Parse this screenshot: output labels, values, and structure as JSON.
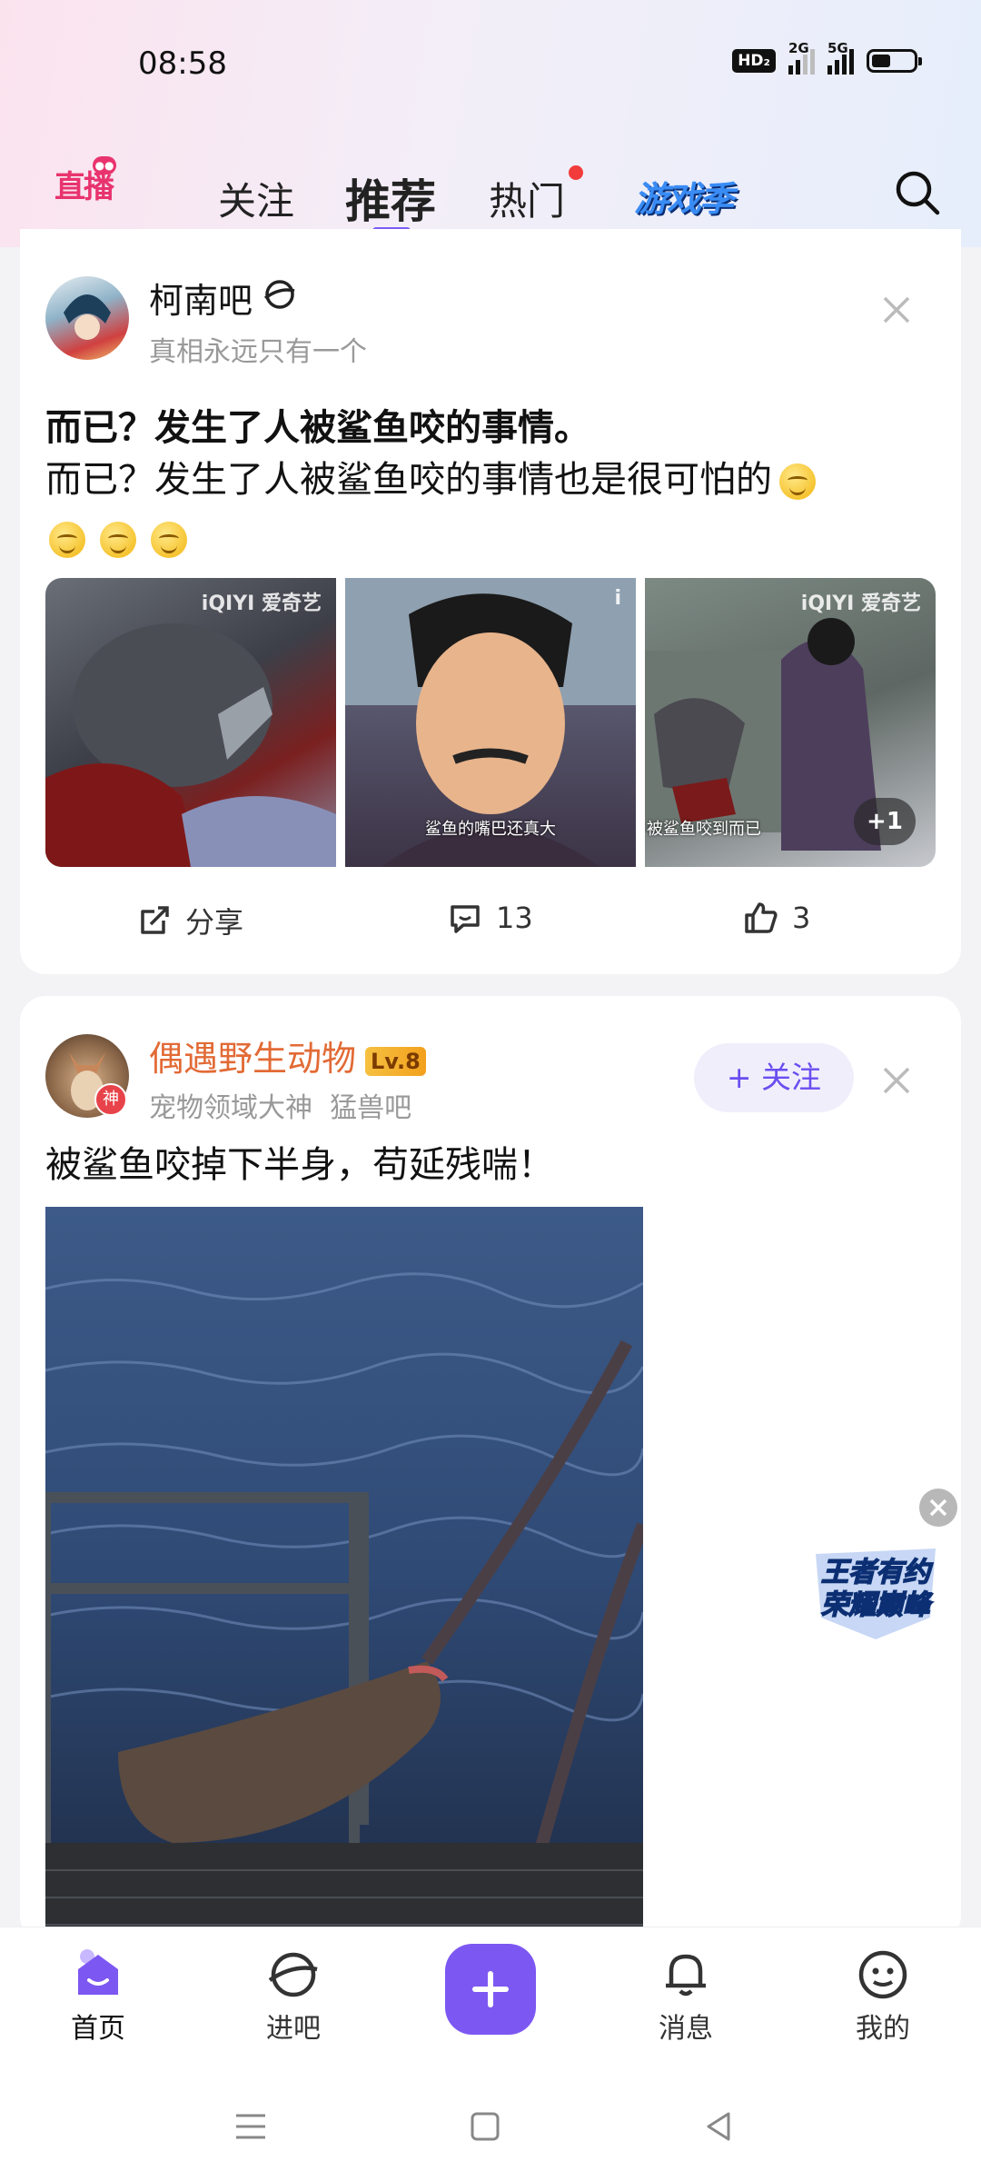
{
  "status_bar": {
    "time": "08:58",
    "hd_label": "HD₂",
    "net1": "2G",
    "net2": "5G",
    "battery_level": 0.45
  },
  "header": {
    "logo_text": "直播",
    "tabs": [
      {
        "label": "关注",
        "active": false
      },
      {
        "label": "推荐",
        "active": true
      },
      {
        "label": "热门",
        "active": false,
        "badge": "red-dot"
      }
    ],
    "game_season_label": "游戏季",
    "accent_color": "#7a5cf5"
  },
  "post1": {
    "forum_name": "柯南吧",
    "forum_sub": "真相永远只有一个",
    "title": "而已？发生了人被鲨鱼咬的事情。",
    "body": "而已？发生了人被鲨鱼咬的事情也是很可怕的",
    "images": [
      {
        "watermark": "iQIYI 爱奇艺",
        "caption": ""
      },
      {
        "watermark": "i",
        "caption": "鲨鱼的嘴巴还真大"
      },
      {
        "watermark": "iQIYI 爱奇艺",
        "caption": "被鲨鱼咬到而已"
      }
    ],
    "more_images": "+1",
    "actions": {
      "share_label": "分享",
      "comments": "13",
      "likes": "3"
    }
  },
  "post2": {
    "author": "偶遇野生动物",
    "level": "Lv.8",
    "avatar_badge": "神",
    "sub_title": "宠物领域大神",
    "sub_forum": "猛兽吧",
    "follow_label": "+ 关注",
    "text": "被鲨鱼咬掉下半身，苟延残喘！"
  },
  "floating_ad": {
    "line1": "王者有约",
    "line2": "荣耀巅峰"
  },
  "bottom_nav": [
    {
      "label": "首页",
      "icon": "home-icon",
      "active": true
    },
    {
      "label": "进吧",
      "icon": "planet-icon",
      "active": false
    },
    {
      "label": "",
      "icon": "plus-icon",
      "active": false
    },
    {
      "label": "消息",
      "icon": "bell-icon",
      "active": false
    },
    {
      "label": "我的",
      "icon": "smile-icon",
      "active": false
    }
  ]
}
